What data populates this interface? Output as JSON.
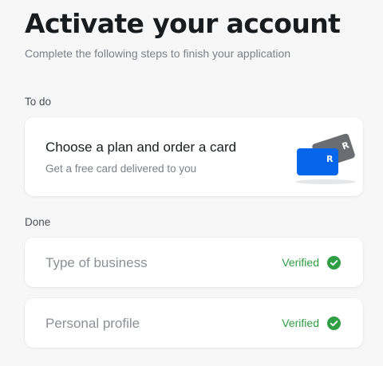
{
  "header": {
    "title": "Activate your account",
    "subtitle": "Complete the following steps to finish your application"
  },
  "todo": {
    "section_label": "To do",
    "task": {
      "title": "Choose a plan and order a card",
      "subtitle": "Get a free card delivered to you",
      "illustration_icon": "payment-cards-icon",
      "card_letter": "R",
      "colors": {
        "front_card": "#0666eb",
        "back_card": "#6a6e73"
      }
    }
  },
  "done": {
    "section_label": "Done",
    "items": [
      {
        "title": "Type of business",
        "status": "Verified",
        "icon": "check-circle-icon"
      },
      {
        "title": "Personal profile",
        "status": "Verified",
        "icon": "check-circle-icon"
      }
    ]
  },
  "colors": {
    "background": "#f7f7f8",
    "verified": "#2f9e44"
  }
}
